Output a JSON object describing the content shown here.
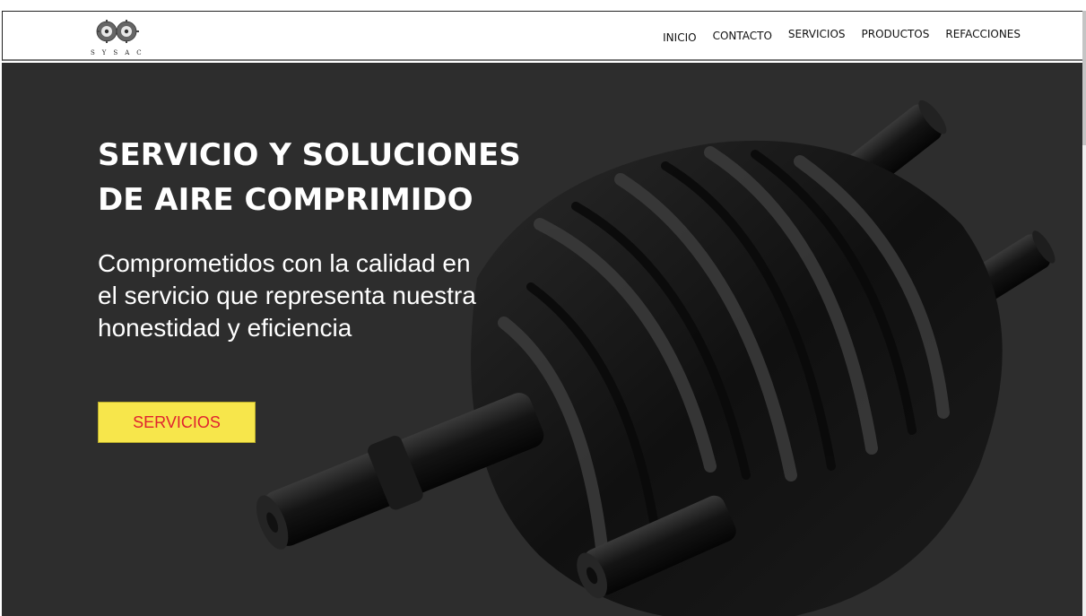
{
  "brand": {
    "logo_text": "SYSAC"
  },
  "nav": {
    "items": [
      {
        "label": "INICIO"
      },
      {
        "label": "CONTACTO"
      },
      {
        "label": "SERVICIOS"
      },
      {
        "label": "PRODUCTOS"
      },
      {
        "label": "REFACCIONES"
      }
    ]
  },
  "hero": {
    "headline_line1": "SERVICIO Y SOLUCIONES",
    "headline_line2": "DE AIRE COMPRIMIDO",
    "subhead": "Comprometidos con la calidad en el servicio que representa nuestra honestidad y eficiencia",
    "cta_label": "SERVICIOS"
  },
  "colors": {
    "hero_bg": "#2d2d2d",
    "cta_bg": "#f7e64b",
    "cta_text": "#e0222f"
  },
  "icons": {
    "logo": "twin-gears-logo-icon",
    "hero_image": "screw-compressor-rotors-image"
  }
}
